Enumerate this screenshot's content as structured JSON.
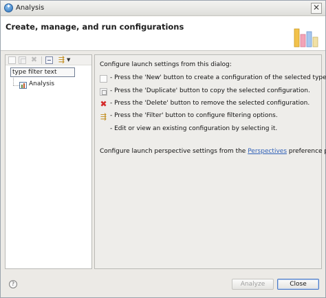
{
  "window": {
    "title": "Analysis"
  },
  "header": {
    "title": "Create, manage, and run configurations"
  },
  "tree": {
    "filter_text": "type filter text",
    "items": [
      {
        "label": "Analysis"
      }
    ]
  },
  "info": {
    "intro": "Configure launch settings from this dialog:",
    "rows": [
      {
        "text": "- Press the 'New' button to create a configuration of the selected type."
      },
      {
        "text": "- Press the 'Duplicate' button to copy the selected configuration."
      },
      {
        "text": "- Press the 'Delete' button to remove the selected configuration."
      },
      {
        "text": "- Press the 'Filter' button to configure filtering options."
      },
      {
        "text": "- Edit or view an existing configuration by selecting it."
      }
    ],
    "perspective_prefix": "Configure launch perspective settings from the ",
    "perspective_link": "Perspectives",
    "perspective_suffix": " preference page."
  },
  "buttons": {
    "help": "?",
    "analyze": "Analyze",
    "close": "Close"
  },
  "colors": {
    "accent": "#2e5fb7",
    "delete_red": "#d42a2a",
    "dialog_bg": "#eceae6"
  }
}
